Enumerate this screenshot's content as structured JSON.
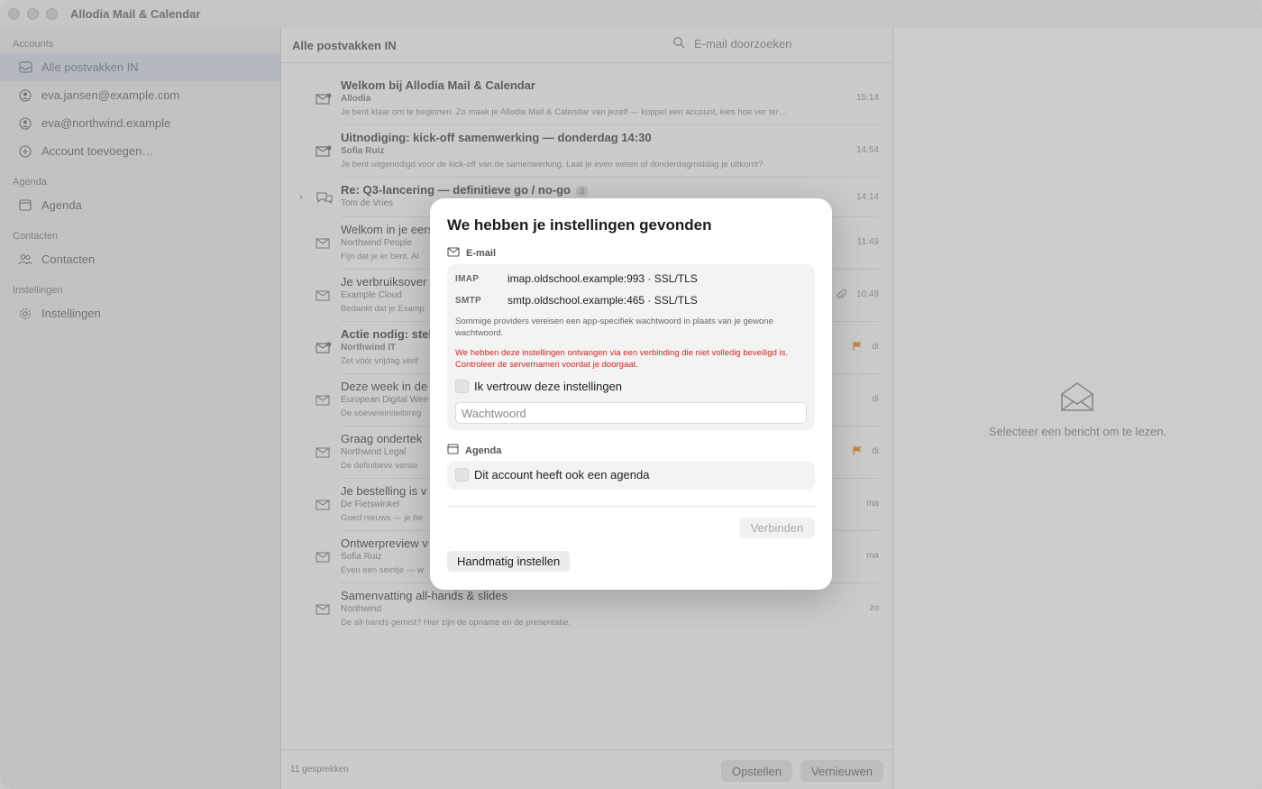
{
  "app": {
    "title": "Allodia Mail & Calendar"
  },
  "sidebar": {
    "sections": [
      {
        "label": "Accounts"
      },
      {
        "label": "Agenda"
      },
      {
        "label": "Contacten"
      },
      {
        "label": "Instellingen"
      }
    ],
    "items": [
      {
        "label": "Alle postvakken IN",
        "icon": "inbox-icon"
      },
      {
        "label": "eva.jansen@example.com",
        "icon": "user-icon"
      },
      {
        "label": "eva@northwind.example",
        "icon": "user-icon"
      },
      {
        "label": "Account toevoegen…",
        "icon": "plus-circle-icon"
      },
      {
        "label": "Agenda",
        "icon": "calendar-icon"
      },
      {
        "label": "Contacten",
        "icon": "people-icon"
      },
      {
        "label": "Instellingen",
        "icon": "gear-icon"
      }
    ]
  },
  "list": {
    "title": "Alle postvakken IN",
    "search_placeholder": "E-mail doorzoeken",
    "messages": [
      {
        "subject": "Welkom bij Allodia Mail & Calendar",
        "from": "Allodia",
        "preview": "Je bent klaar om te beginnen. Zo maak je Allodia Mail & Calendar van jezelf — koppel een account, kies hoe ver ter…",
        "time": "15:14"
      },
      {
        "subject": "Uitnodiging: kick-off samenwerking — donderdag 14:30",
        "from": "Sofia Ruiz",
        "preview": "Je bent uitgenodigd voor de kick-off van de samenwerking. Laat je even weten of donderdagmiddag je uitkomt?",
        "time": "14:54"
      },
      {
        "subject": "Re: Q3-lancering — definitieve go / no-go",
        "count": "3",
        "from": "Tom de Vries",
        "preview": "",
        "time": "14:14"
      },
      {
        "subject": "Welkom in je eers",
        "from": "Northwind People",
        "preview": "Fijn dat je er bent. Al",
        "time": "11:49"
      },
      {
        "subject": "Je verbruiksover",
        "from": "Example Cloud",
        "preview": "Bedankt dat je Examp",
        "time": "10:49"
      },
      {
        "subject": "Actie nodig: stel",
        "from": "Northwind IT",
        "preview": "Zet vóór vrijdag verif",
        "time": "di"
      },
      {
        "subject": "Deze week in de",
        "from": "European Digital Wee",
        "preview": "De soevereiniteitsreg",
        "time": "di"
      },
      {
        "subject": "Graag ondertek",
        "from": "Northwind Legal",
        "preview": "De definitieve versie",
        "time": "di"
      },
      {
        "subject": "Je bestelling is v",
        "from": "De Fietswinkel",
        "preview": "Goed nieuws — je be",
        "time": "ma"
      },
      {
        "subject": "Ontwerpreview v",
        "from": "Sofia Ruiz",
        "preview": "Even een seintje — w",
        "time": "ma"
      },
      {
        "subject": "Samenvatting all-hands & slides",
        "from": "Northwind",
        "preview": "De all-hands gemist? Hier zijn de opname en de presentatie.",
        "time": "zo"
      }
    ],
    "footer": {
      "count": "11 gesprekken",
      "compose": "Opstellen",
      "refresh": "Vernieuwen"
    }
  },
  "reader": {
    "empty": "Selecteer een bericht om te lezen."
  },
  "dialog": {
    "title": "We hebben je instellingen gevonden",
    "email_section": "E-mail",
    "imap_key": "IMAP",
    "imap_value": "imap.oldschool.example:993 · SSL/TLS",
    "smtp_key": "SMTP",
    "smtp_value": "smtp.oldschool.example:465 · SSL/TLS",
    "note": "Sommige providers vereisen een app-specifiek wachtwoord in plaats van je gewone wachtwoord.",
    "warning": "We hebben deze instellingen ontvangen via een verbinding die niet volledig beveiligd is. Controleer de servernamen voordat je doorgaat.",
    "trust_label": "Ik vertrouw deze instellingen",
    "password_placeholder": "Wachtwoord",
    "agenda_section": "Agenda",
    "agenda_label": "Dit account heeft ook een agenda",
    "connect": "Verbinden",
    "manual": "Handmatig instellen"
  },
  "colors": {
    "warning": "#d32424",
    "flag": "#e8a25a",
    "selection": "#d8dde4"
  }
}
